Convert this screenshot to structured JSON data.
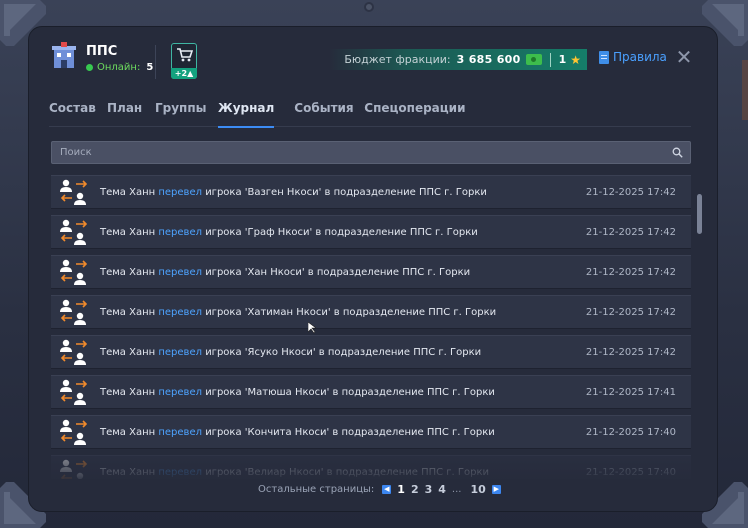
{
  "header": {
    "faction_name": "ППС",
    "online_label": "Онлайн:",
    "online_count": "5",
    "cart_badge": "+2",
    "budget_label": "Бюджет фракции:",
    "budget_value": "3 685 600",
    "level": "1",
    "rules_label": "Правила",
    "close_label": "✕"
  },
  "tabs": [
    {
      "label": "Состав",
      "active": false
    },
    {
      "label": "План",
      "active": false
    },
    {
      "label": "Группы",
      "active": false
    },
    {
      "label": "Журнал",
      "active": true
    },
    {
      "label": "События",
      "active": false
    },
    {
      "label": "Спецоперации",
      "active": false
    }
  ],
  "search": {
    "placeholder": "Поиск"
  },
  "log": [
    {
      "actor": "Тема Ханн",
      "action": "перевел",
      "rest": "игрока 'Вазген Нкоси' в подразделение ППС г. Горки",
      "time": "21-12-2025 17:42"
    },
    {
      "actor": "Тема Ханн",
      "action": "перевел",
      "rest": "игрока 'Граф Нкоси' в подразделение ППС г. Горки",
      "time": "21-12-2025 17:42"
    },
    {
      "actor": "Тема Ханн",
      "action": "перевел",
      "rest": "игрока 'Хан Нкоси' в подразделение ППС г. Горки",
      "time": "21-12-2025 17:42"
    },
    {
      "actor": "Тема Ханн",
      "action": "перевел",
      "rest": "игрока 'Хатиман Нкоси' в подразделение ППС г. Горки",
      "time": "21-12-2025 17:42"
    },
    {
      "actor": "Тема Ханн",
      "action": "перевел",
      "rest": "игрока 'Ясуко Нкоси' в подразделение ППС г. Горки",
      "time": "21-12-2025 17:42"
    },
    {
      "actor": "Тема Ханн",
      "action": "перевел",
      "rest": "игрока 'Матюша Нкоси' в подразделение ППС г. Горки",
      "time": "21-12-2025 17:41"
    },
    {
      "actor": "Тема Ханн",
      "action": "перевел",
      "rest": "игрока 'Кончита Нкоси' в подразделение ППС г. Горки",
      "time": "21-12-2025 17:40"
    },
    {
      "actor": "Тема Ханн",
      "action": "перевел",
      "rest": "игрока 'Велиар Нкоси' в подразделение ППС г. Горки",
      "time": "21-12-2025 17:40"
    }
  ],
  "pagination": {
    "label": "Остальные страницы:",
    "pages": [
      "1",
      "2",
      "3",
      "4"
    ],
    "ellipsis": "...",
    "last": "10",
    "current": "1"
  },
  "colors": {
    "accent": "#3c8cf5",
    "action_text": "#4da3ff",
    "online": "#37c950",
    "budget_bg": "#157d69",
    "star": "#ffc531"
  }
}
